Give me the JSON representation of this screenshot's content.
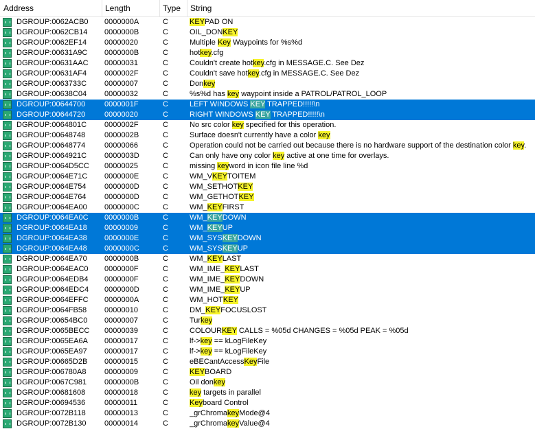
{
  "columns": {
    "address": "Address",
    "length": "Length",
    "type": "Type",
    "string": "String"
  },
  "rows": [
    {
      "addr": "DGROUP:0062ACB0",
      "len": "0000000A",
      "type": "C",
      "pre": "",
      "key": "KEY",
      "post": "PAD ON",
      "sel": false
    },
    {
      "addr": "DGROUP:0062CB14",
      "len": "0000000B",
      "type": "C",
      "pre": "OIL_DON",
      "key": "KEY",
      "post": "",
      "sel": false
    },
    {
      "addr": "DGROUP:0062EF14",
      "len": "00000020",
      "type": "C",
      "pre": "Multiple ",
      "key": "Key",
      "post": " Waypoints for %s%d",
      "sel": false
    },
    {
      "addr": "DGROUP:00631A9C",
      "len": "0000000B",
      "type": "C",
      "pre": "hot",
      "key": "key",
      "post": ".cfg",
      "sel": false
    },
    {
      "addr": "DGROUP:00631AAC",
      "len": "00000031",
      "type": "C",
      "pre": "Couldn't create hot",
      "key": "key",
      "post": ".cfg in MESSAGE.C. See Dez",
      "sel": false
    },
    {
      "addr": "DGROUP:00631AF4",
      "len": "0000002F",
      "type": "C",
      "pre": "Couldn't save hot",
      "key": "key",
      "post": ".cfg in MESSAGE.C. See Dez",
      "sel": false
    },
    {
      "addr": "DGROUP:0063733C",
      "len": "00000007",
      "type": "C",
      "pre": "Don",
      "key": "key",
      "post": "",
      "sel": false
    },
    {
      "addr": "DGROUP:00638C04",
      "len": "00000032",
      "type": "C",
      "pre": "%s%d has ",
      "key": "key",
      "post": " waypoint inside a PATROL/PATROL_LOOP",
      "sel": false
    },
    {
      "addr": "DGROUP:00644700",
      "len": "0000001F",
      "type": "C",
      "pre": "LEFT WINDOWS ",
      "key": "KEY",
      "post": " TRAPPED!!!!!\\n",
      "sel": true
    },
    {
      "addr": "DGROUP:00644720",
      "len": "00000020",
      "type": "C",
      "pre": "RIGHT WINDOWS ",
      "key": "KEY",
      "post": " TRAPPED!!!!!\\n",
      "sel": true
    },
    {
      "addr": "DGROUP:0064801C",
      "len": "0000002F",
      "type": "C",
      "pre": "No src color ",
      "key": "key",
      "post": " specified for this operation.",
      "sel": false
    },
    {
      "addr": "DGROUP:00648748",
      "len": "0000002B",
      "type": "C",
      "pre": "Surface doesn't currently have a color ",
      "key": "key",
      "post": "",
      "sel": false
    },
    {
      "addr": "DGROUP:00648774",
      "len": "00000066",
      "type": "C",
      "pre": "Operation could not be carried out because there is no hardware support of the destination color ",
      "key": "key",
      "post": ".",
      "sel": false
    },
    {
      "addr": "DGROUP:0064921C",
      "len": "0000003D",
      "type": "C",
      "pre": "Can only have ony color ",
      "key": "key",
      "post": " active at one time for overlays.",
      "sel": false
    },
    {
      "addr": "DGROUP:0064D5CC",
      "len": "00000025",
      "type": "C",
      "pre": "missing ",
      "key": "key",
      "post": "word in icon file line %d",
      "sel": false
    },
    {
      "addr": "DGROUP:0064E71C",
      "len": "0000000E",
      "type": "C",
      "pre": "WM_V",
      "key": "KEY",
      "post": "TOITEM",
      "sel": false
    },
    {
      "addr": "DGROUP:0064E754",
      "len": "0000000D",
      "type": "C",
      "pre": "WM_SETHOT",
      "key": "KEY",
      "post": "",
      "sel": false
    },
    {
      "addr": "DGROUP:0064E764",
      "len": "0000000D",
      "type": "C",
      "pre": "WM_GETHOT",
      "key": "KEY",
      "post": "",
      "sel": false
    },
    {
      "addr": "DGROUP:0064EA00",
      "len": "0000000C",
      "type": "C",
      "pre": "WM_",
      "key": "KEY",
      "post": "FIRST",
      "sel": false
    },
    {
      "addr": "DGROUP:0064EA0C",
      "len": "0000000B",
      "type": "C",
      "pre": "WM_",
      "key": "KEY",
      "post": "DOWN",
      "sel": true
    },
    {
      "addr": "DGROUP:0064EA18",
      "len": "00000009",
      "type": "C",
      "pre": "WM_",
      "key": "KEY",
      "post": "UP",
      "sel": true
    },
    {
      "addr": "DGROUP:0064EA38",
      "len": "0000000E",
      "type": "C",
      "pre": "WM_SYS",
      "key": "KEY",
      "post": "DOWN",
      "sel": true
    },
    {
      "addr": "DGROUP:0064EA48",
      "len": "0000000C",
      "type": "C",
      "pre": "WM_SYS",
      "key": "KEY",
      "post": "UP",
      "sel": true
    },
    {
      "addr": "DGROUP:0064EA70",
      "len": "0000000B",
      "type": "C",
      "pre": "WM_",
      "key": "KEY",
      "post": "LAST",
      "sel": false
    },
    {
      "addr": "DGROUP:0064EAC0",
      "len": "0000000F",
      "type": "C",
      "pre": "WM_IME_",
      "key": "KEY",
      "post": "LAST",
      "sel": false
    },
    {
      "addr": "DGROUP:0064EDB4",
      "len": "0000000F",
      "type": "C",
      "pre": "WM_IME_",
      "key": "KEY",
      "post": "DOWN",
      "sel": false
    },
    {
      "addr": "DGROUP:0064EDC4",
      "len": "0000000D",
      "type": "C",
      "pre": "WM_IME_",
      "key": "KEY",
      "post": "UP",
      "sel": false
    },
    {
      "addr": "DGROUP:0064EFFC",
      "len": "0000000A",
      "type": "C",
      "pre": "WM_HOT",
      "key": "KEY",
      "post": "",
      "sel": false
    },
    {
      "addr": "DGROUP:0064FB58",
      "len": "00000010",
      "type": "C",
      "pre": "DM_",
      "key": "KEY",
      "post": "FOCUSLOST",
      "sel": false
    },
    {
      "addr": "DGROUP:00654BC0",
      "len": "00000007",
      "type": "C",
      "pre": "Tur",
      "key": "key",
      "post": "",
      "sel": false
    },
    {
      "addr": "DGROUP:0065BECC",
      "len": "00000039",
      "type": "C",
      "pre": "COLOUR",
      "key": "KEY",
      "post": "     CALLS = %05d  CHANGES = %05d  PEAK = %05d",
      "sel": false
    },
    {
      "addr": "DGROUP:0065EA6A",
      "len": "00000017",
      "type": "C",
      "pre": "lf->",
      "key": "key",
      "post": " == kLogFileKey",
      "sel": false
    },
    {
      "addr": "DGROUP:0065EA97",
      "len": "00000017",
      "type": "C",
      "pre": "lf->",
      "key": "key",
      "post": " == kLogFileKey",
      "sel": false
    },
    {
      "addr": "DGROUP:00665D2B",
      "len": "00000015",
      "type": "C",
      "pre": "eBECantAccess",
      "key": "Key",
      "post": "File",
      "sel": false
    },
    {
      "addr": "DGROUP:006780A8",
      "len": "00000009",
      "type": "C",
      "pre": "",
      "key": "KEY",
      "post": "BOARD",
      "sel": false
    },
    {
      "addr": "DGROUP:0067C981",
      "len": "0000000B",
      "type": "C",
      "pre": "Oil don",
      "key": "key",
      "post": "",
      "sel": false
    },
    {
      "addr": "DGROUP:00681608",
      "len": "00000018",
      "type": "C",
      "pre": "",
      "key": "key",
      "post": " targets in parallel",
      "sel": false
    },
    {
      "addr": "DGROUP:00694536",
      "len": "00000011",
      "type": "C",
      "pre": "",
      "key": "Key",
      "post": "board Control",
      "sel": false
    },
    {
      "addr": "DGROUP:0072B118",
      "len": "00000013",
      "type": "C",
      "pre": "_grChroma",
      "key": "key",
      "post": "Mode@4",
      "sel": false
    },
    {
      "addr": "DGROUP:0072B130",
      "len": "00000014",
      "type": "C",
      "pre": "_grChroma",
      "key": "key",
      "post": "Value@4",
      "sel": false
    }
  ],
  "colors": {
    "selection": "#0078d7",
    "highlight": "#f6f32a",
    "icon": "#2aa872"
  }
}
